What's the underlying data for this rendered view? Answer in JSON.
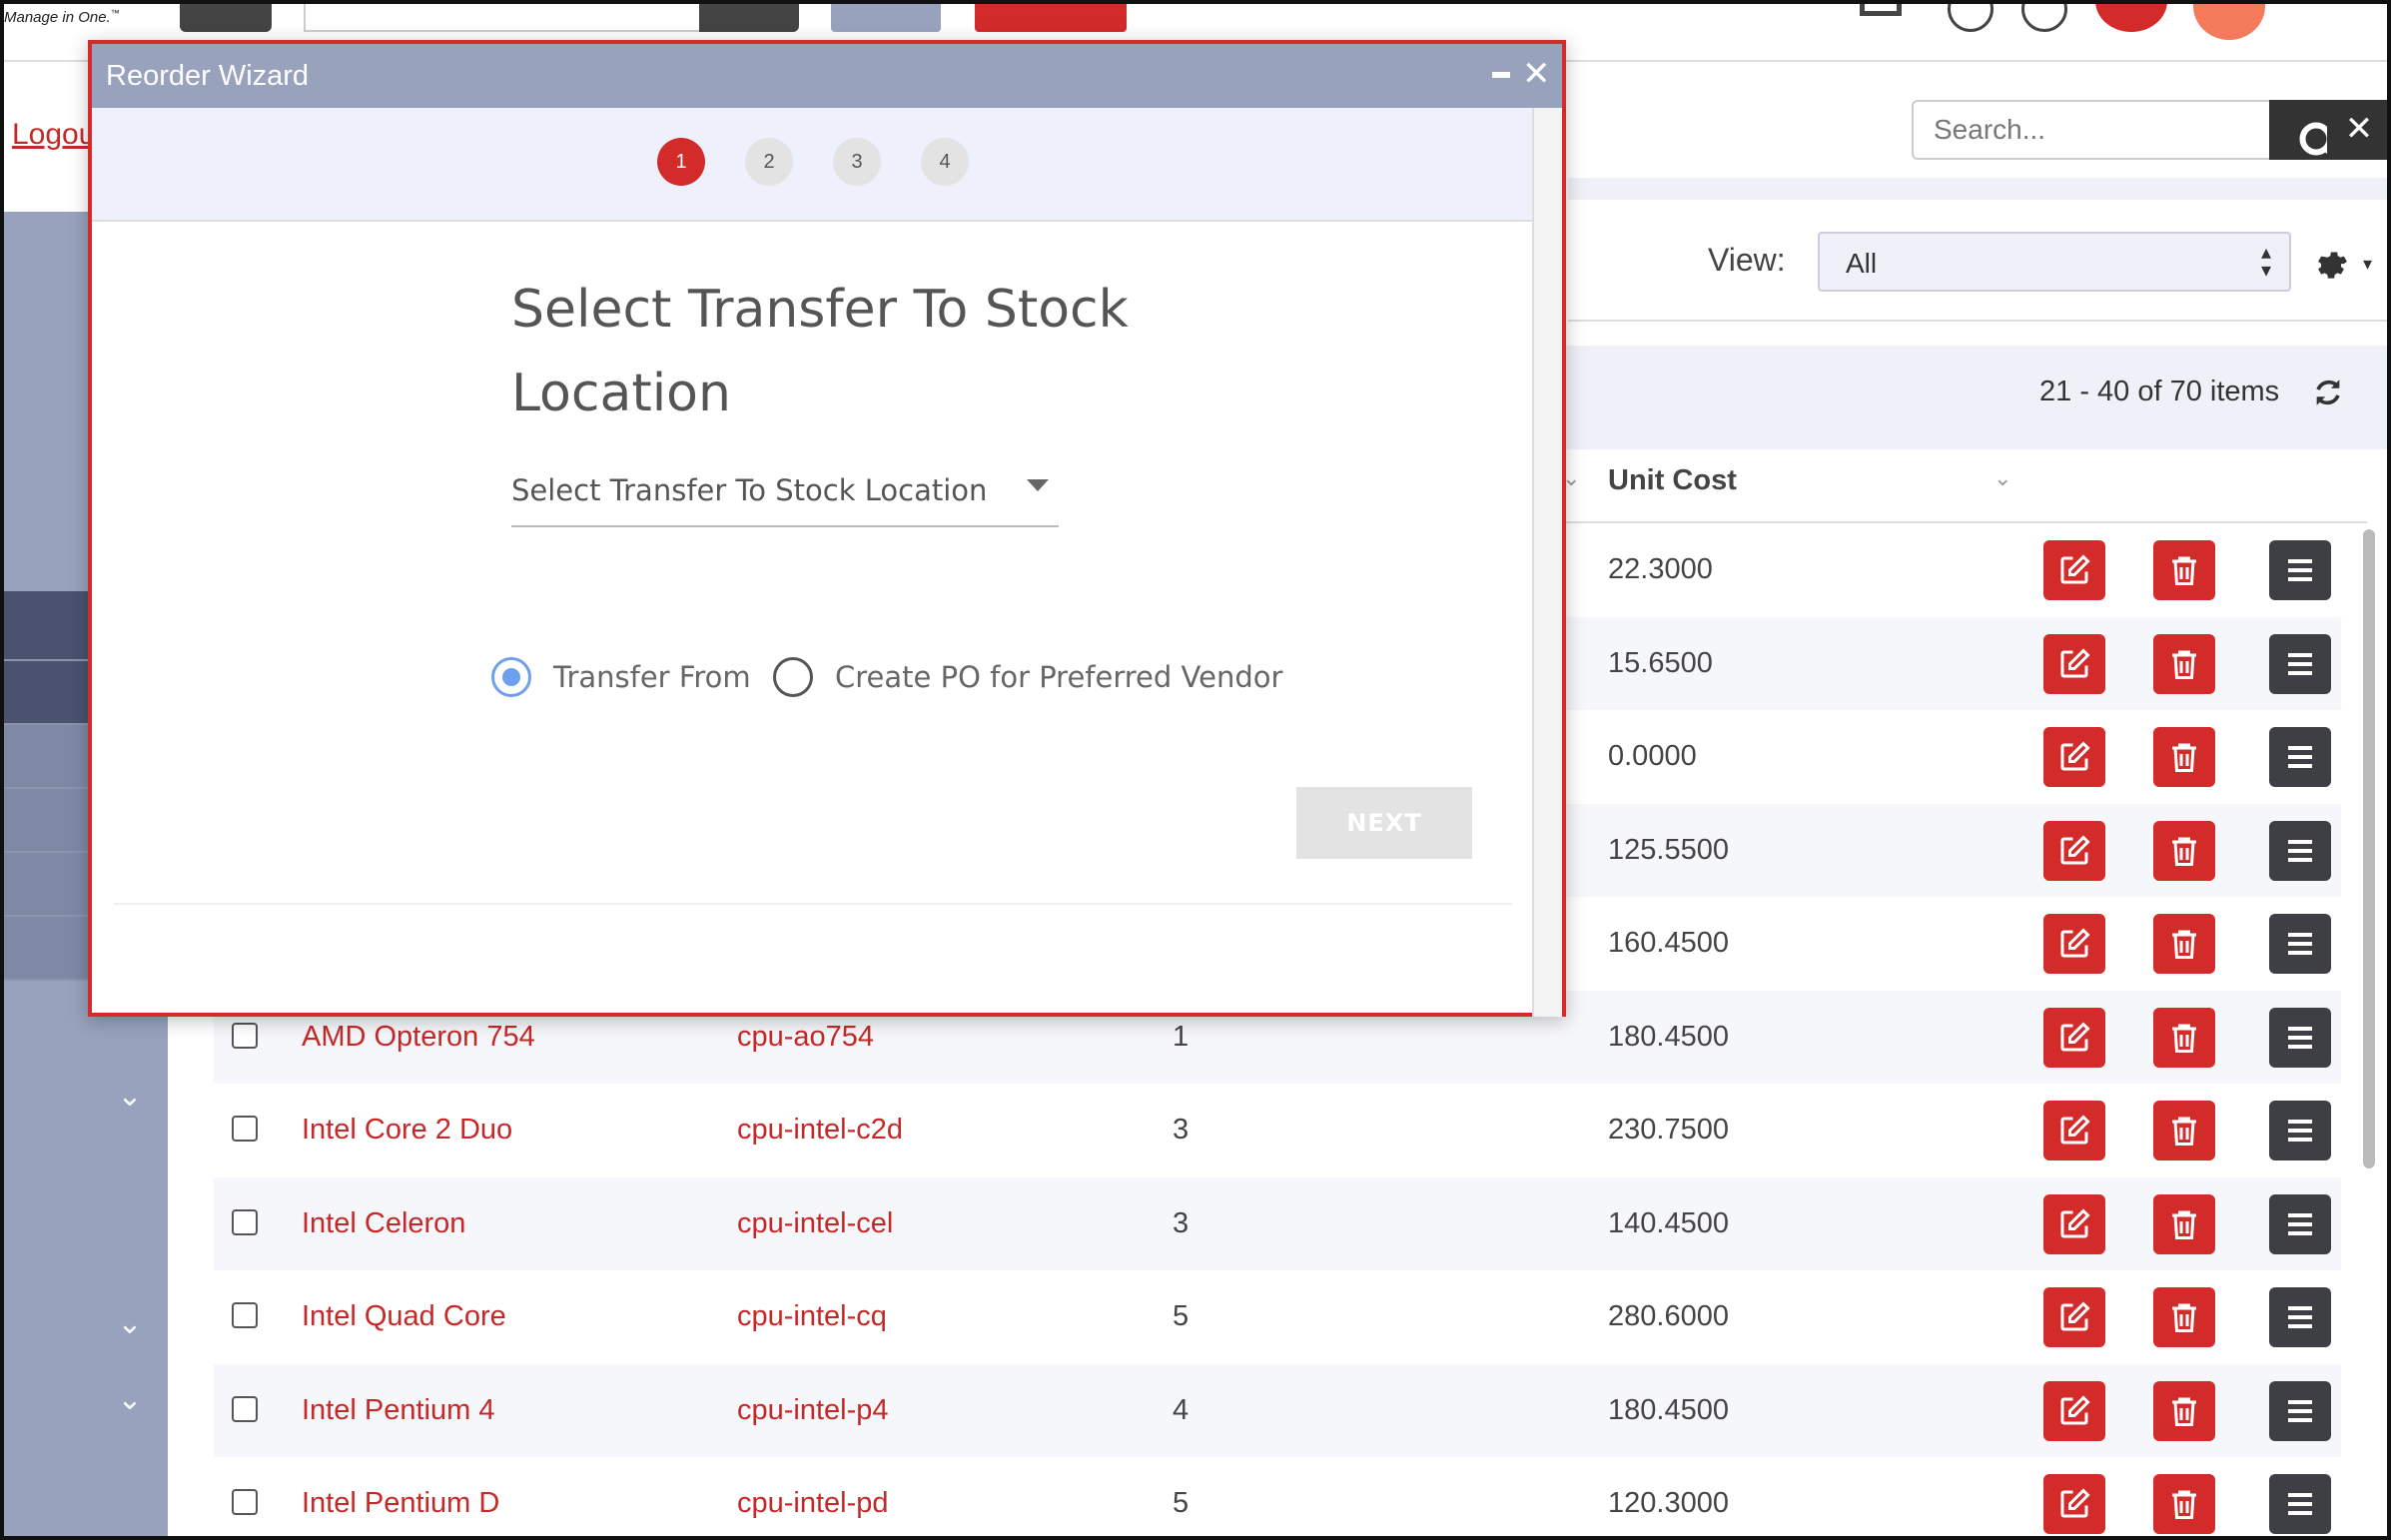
{
  "topbar": {
    "tagline": "Manage in One.",
    "tagline_tm": "™"
  },
  "sidebar": {
    "logout_label": "Logou"
  },
  "header": {
    "search_placeholder": "Search...",
    "view_label": "View:",
    "view_selected": "All",
    "pager_text": "21 - 40 of 70 items",
    "unit_cost_header": "Unit Cost"
  },
  "table": {
    "hidden_rows": [
      {
        "cost": "22.3000"
      },
      {
        "cost": "15.6500"
      },
      {
        "cost": "0.0000"
      },
      {
        "cost": "125.5500"
      },
      {
        "cost": "160.4500"
      }
    ],
    "rows": [
      {
        "name": "AMD Opteron 754",
        "sku": "cpu-ao754",
        "qty": "1",
        "cost": "180.4500"
      },
      {
        "name": "Intel Core 2 Duo",
        "sku": "cpu-intel-c2d",
        "qty": "3",
        "cost": "230.7500"
      },
      {
        "name": "Intel Celeron",
        "sku": "cpu-intel-cel",
        "qty": "3",
        "cost": "140.4500"
      },
      {
        "name": "Intel Quad Core",
        "sku": "cpu-intel-cq",
        "qty": "5",
        "cost": "280.6000"
      },
      {
        "name": "Intel Pentium 4",
        "sku": "cpu-intel-p4",
        "qty": "4",
        "cost": "180.4500"
      },
      {
        "name": "Intel Pentium D",
        "sku": "cpu-intel-pd",
        "qty": "5",
        "cost": "120.3000"
      }
    ]
  },
  "modal": {
    "title": "Reorder Wizard",
    "steps": [
      "1",
      "2",
      "3",
      "4"
    ],
    "active_step": "1",
    "heading": "Select Transfer To Stock Location",
    "select_placeholder": "Select Transfer To Stock Location",
    "radio_transfer_from": "Transfer From",
    "radio_create_po": "Create PO for Preferred Vendor",
    "next_label": "NEXT"
  },
  "icons": {
    "search": "search-icon",
    "close": "close-icon",
    "gear": "gear-icon",
    "refresh": "refresh-icon",
    "edit": "edit-icon",
    "delete": "trash-icon",
    "menu": "hamburger-icon"
  },
  "colors": {
    "brand_red": "#d32a2a",
    "slate": "#98a2bd",
    "dark_button": "#3d3f45",
    "radio_blue": "#6ea0f0"
  }
}
